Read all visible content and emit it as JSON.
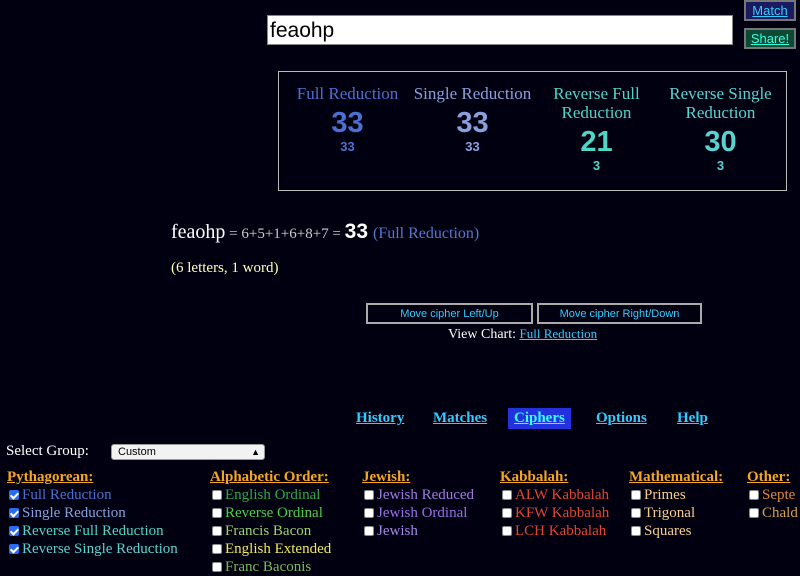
{
  "search": {
    "value": "feaohp"
  },
  "buttons": {
    "match": "Match",
    "share": "Share!"
  },
  "summary": [
    {
      "name": "Full Reduction",
      "value": "33",
      "sub": "33",
      "color": "#4d6fd1"
    },
    {
      "name": "Single Reduction",
      "value": "33",
      "sub": "33",
      "color": "#8aa0dc"
    },
    {
      "name": "Reverse Full Reduction",
      "value": "21",
      "sub": "3",
      "color": "#4fd6c6"
    },
    {
      "name": "Reverse Single Reduction",
      "value": "30",
      "sub": "3",
      "color": "#5ad3d0"
    }
  ],
  "equation": {
    "word": "feaohp",
    "expr": " = 6+5+1+6+8+7 = ",
    "total": "33",
    "cipher": "(Full Reduction)"
  },
  "count": "(6 letters, 1 word)",
  "move": {
    "left": "Move cipher Left/Up",
    "right": "Move cipher Right/Down"
  },
  "chart": {
    "label": "View Chart:",
    "link": "Full Reduction"
  },
  "nav": [
    {
      "label": "History",
      "active": false
    },
    {
      "label": "Matches",
      "active": false
    },
    {
      "label": "Ciphers",
      "active": true
    },
    {
      "label": "Options",
      "active": false
    },
    {
      "label": "Help",
      "active": false
    }
  ],
  "select_group": {
    "label": "Select Group:",
    "value": "Custom"
  },
  "groups": [
    {
      "title": "Pythagorean:",
      "color": "#f5a623",
      "items": [
        {
          "label": "Full Reduction",
          "checked": true,
          "color": "#4d6fd1"
        },
        {
          "label": "Single Reduction",
          "checked": true,
          "color": "#8aa0dc"
        },
        {
          "label": "Reverse Full Reduction",
          "checked": true,
          "color": "#4fd6c6"
        },
        {
          "label": "Reverse Single Reduction",
          "checked": true,
          "color": "#5ad3d0"
        }
      ]
    },
    {
      "title": "Alphabetic Order:",
      "color": "#f5a623",
      "items": [
        {
          "label": "English Ordinal",
          "checked": false,
          "color": "#2fa84f"
        },
        {
          "label": "Reverse Ordinal",
          "checked": false,
          "color": "#49d049"
        },
        {
          "label": "Francis Bacon",
          "checked": false,
          "color": "#9ad36a"
        },
        {
          "label": "English Extended",
          "checked": false,
          "color": "#f1e85a"
        },
        {
          "label": "Franc Baconis",
          "checked": false,
          "color": "#7fb85a"
        }
      ]
    },
    {
      "title": "Jewish:",
      "color": "#f5a623",
      "items": [
        {
          "label": "Jewish Reduced",
          "checked": false,
          "color": "#a07be0"
        },
        {
          "label": "Jewish Ordinal",
          "checked": false,
          "color": "#9a6fe6"
        },
        {
          "label": "Jewish",
          "checked": false,
          "color": "#a587e8"
        }
      ]
    },
    {
      "title": "Kabbalah:",
      "color": "#f5a623",
      "items": [
        {
          "label": "ALW Kabbalah",
          "checked": false,
          "color": "#e2462f"
        },
        {
          "label": "KFW Kabbalah",
          "checked": false,
          "color": "#e2462f"
        },
        {
          "label": "LCH Kabbalah",
          "checked": false,
          "color": "#e2462f"
        }
      ]
    },
    {
      "title": "Mathematical:",
      "color": "#f5a623",
      "items": [
        {
          "label": "Primes",
          "checked": false,
          "color": "#f5cf8a"
        },
        {
          "label": "Trigonal",
          "checked": false,
          "color": "#f5cf8a"
        },
        {
          "label": "Squares",
          "checked": false,
          "color": "#f5cf8a"
        }
      ]
    },
    {
      "title": "Other:",
      "color": "#f5a623",
      "items": [
        {
          "label": "Septe",
          "checked": false,
          "color": "#e0883a"
        },
        {
          "label": "Chald",
          "checked": false,
          "color": "#d2a04a"
        }
      ]
    }
  ]
}
